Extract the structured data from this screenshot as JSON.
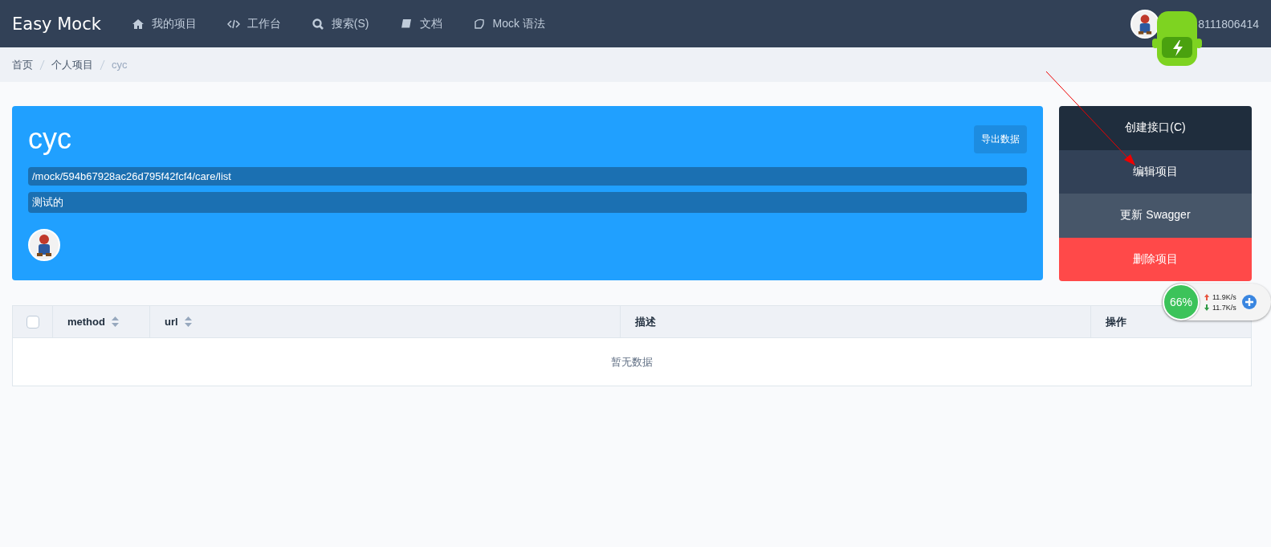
{
  "header": {
    "logo": "Easy Mock",
    "nav": [
      {
        "label": "我的项目"
      },
      {
        "label": "工作台"
      },
      {
        "label": "搜索(S)"
      },
      {
        "label": "文档"
      },
      {
        "label": "Mock 语法"
      }
    ],
    "user": {
      "name": "8111806414"
    }
  },
  "breadcrumb": [
    {
      "label": "首页",
      "current": false
    },
    {
      "label": "个人项目",
      "current": false
    },
    {
      "label": "cyc",
      "current": true
    }
  ],
  "project": {
    "name": "cyc",
    "export_button": "导出数据",
    "url": "/mock/594b67928ac26d795f42fcf4/care/list",
    "description": "测试的"
  },
  "actions": [
    {
      "label": "创建接口(C)",
      "kind": "create"
    },
    {
      "label": "编辑项目",
      "kind": "edit"
    },
    {
      "label": "更新 Swagger",
      "kind": "swagger"
    },
    {
      "label": "删除项目",
      "kind": "delete"
    }
  ],
  "table": {
    "select_all": {
      "checked": false
    },
    "columns": [
      {
        "label": "method",
        "sortable": true
      },
      {
        "label": "url",
        "sortable": true
      },
      {
        "label": "描述",
        "sortable": false
      },
      {
        "label": "操作",
        "sortable": false
      }
    ],
    "empty_text": "暂无数据"
  },
  "widget": {
    "percent": "66%",
    "upload": "11.9K/s",
    "download": "11.7K/s"
  }
}
